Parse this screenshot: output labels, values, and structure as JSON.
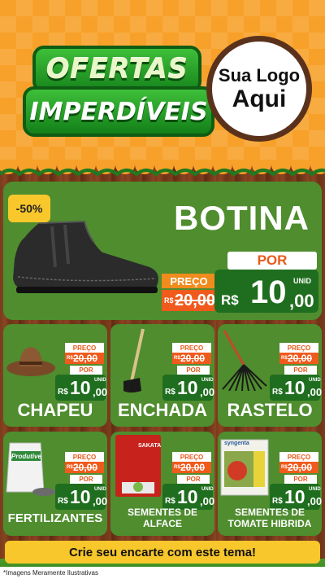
{
  "header": {
    "title_line1": "OFERTAS",
    "title_line2": "IMPERDÍVEIS",
    "logo_line1": "Sua Logo",
    "logo_line2": "Aqui"
  },
  "featured": {
    "discount_badge": "-50%",
    "name": "BOTINA",
    "preco_label": "PREÇO",
    "old_currency": "R$",
    "old_price": "20,00",
    "por_label": "POR",
    "currency": "R$",
    "price_int": "10",
    "price_dec": ",00",
    "unit": "UNID"
  },
  "products": [
    {
      "name": "CHAPEU",
      "preco_label": "PREÇO",
      "old_currency": "R$",
      "old_price": "20,00",
      "por_label": "POR",
      "currency": "R$",
      "price_int": "10",
      "price_dec": ",00",
      "unit": "UNID"
    },
    {
      "name": "ENCHADA",
      "preco_label": "PREÇO",
      "old_currency": "R$",
      "old_price": "20,00",
      "por_label": "POR",
      "currency": "R$",
      "price_int": "10",
      "price_dec": ",00",
      "unit": "UNID"
    },
    {
      "name": "RASTELO",
      "preco_label": "PREÇO",
      "old_currency": "R$",
      "old_price": "20,00",
      "por_label": "POR",
      "currency": "R$",
      "price_int": "10",
      "price_dec": ",00",
      "unit": "UNID"
    },
    {
      "name": "FERTILIZANTES",
      "package_text": "Produtive",
      "preco_label": "PREÇO",
      "old_currency": "R$",
      "old_price": "20,00",
      "por_label": "POR",
      "currency": "R$",
      "price_int": "10",
      "price_dec": ",00",
      "unit": "UNID"
    },
    {
      "name_line1": "SEMENTES DE",
      "name_line2": "ALFACE",
      "package_text": "SAKATA",
      "preco_label": "PREÇO",
      "old_currency": "R$",
      "old_price": "20,00",
      "por_label": "POR",
      "currency": "R$",
      "price_int": "10",
      "price_dec": ",00",
      "unit": "UNID"
    },
    {
      "name_line1": "SEMENTES DE",
      "name_line2": "TOMATE HIBRIDA",
      "package_text": "syngenta",
      "preco_label": "PREÇO",
      "old_currency": "R$",
      "old_price": "20,00",
      "por_label": "POR",
      "currency": "R$",
      "price_int": "10",
      "price_dec": ",00",
      "unit": "UNID"
    }
  ],
  "footer": {
    "cta": "Crie seu encarte com este tema!",
    "disclaimer": "*Imagens Meramente Ilustrativas"
  },
  "colors": {
    "header_orange": "#f7a12a",
    "card_green": "#4f8d2e",
    "price_green": "#1f6e1f",
    "accent_orange": "#f05a1c",
    "badge_yellow": "#f8c72b",
    "wood_brown": "#7a3b1c"
  }
}
